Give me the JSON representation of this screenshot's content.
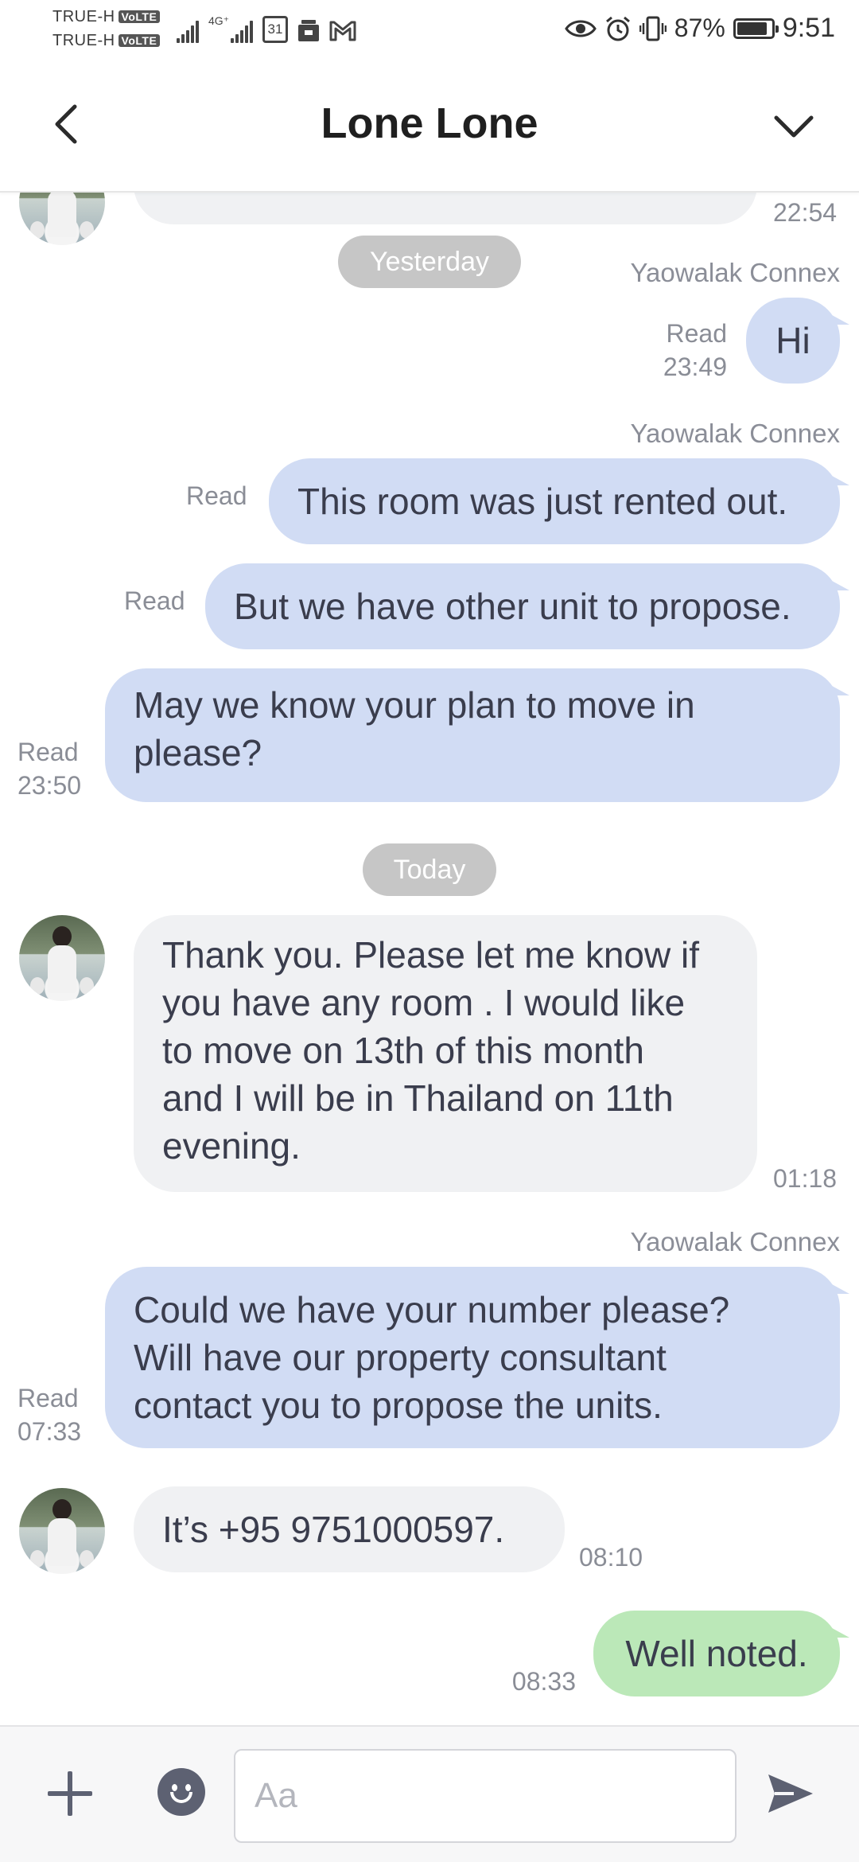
{
  "status_bar": {
    "carrier1": "TRUE-H",
    "carrier2": "TRUE-H",
    "volte": "VoLTE",
    "network": "4G⁺",
    "calendar_day": "31",
    "battery_percent": "87%",
    "battery_level": 0.87,
    "time": "9:51",
    "icons": [
      "signal-icon",
      "signal-4g-icon",
      "calendar-icon",
      "store-icon",
      "gmail-icon",
      "eye-icon",
      "alarm-icon",
      "vibrate-icon",
      "battery-icon"
    ]
  },
  "header": {
    "title": "Lone Lone",
    "back_icon": "chevron-left-icon",
    "menu_icon": "chevron-down-icon"
  },
  "chat": {
    "top_partial_time": "22:54",
    "date_yesterday": "Yesterday",
    "sender_1": "Yaowalak Connex",
    "msg_hi": {
      "text": "Hi",
      "read": "Read",
      "time": "23:49"
    },
    "sender_2": "Yaowalak Connex",
    "msg_rented": {
      "text": "This room was just rented out.",
      "read": "Read"
    },
    "msg_other_unit": {
      "text": "But we have other unit to propose.",
      "read": "Read"
    },
    "msg_plan": {
      "line1": "May we know your plan to move in",
      "line2": "please?",
      "read": "Read",
      "time": "23:50"
    },
    "date_today": "Today",
    "msg_thanks": {
      "line1": "Thank you. Please let me know if",
      "line2": "you have any room . I would like",
      "line3": "to move on 13th of this month",
      "line4": "and I will be in Thailand on 11th",
      "line5": "evening.",
      "time": "01:18"
    },
    "sender_3": "Yaowalak Connex",
    "msg_number": {
      "line1": "Could we have your number please?",
      "line2": "Will have our property consultant",
      "line3": "contact you to propose the units.",
      "read": "Read",
      "time": "07:33"
    },
    "msg_phone": {
      "text": "It’s +95 9751000597.",
      "time": "08:10"
    },
    "msg_noted": {
      "text": "Well noted.",
      "time": "08:33"
    }
  },
  "input_bar": {
    "placeholder": "Aa",
    "value": ""
  },
  "colors": {
    "outgoing_bubble": "#d1dcf4",
    "incoming_bubble": "#f0f1f3",
    "sticker_bubble": "#bbe8b8",
    "date_pill": "#c6c6c6"
  }
}
